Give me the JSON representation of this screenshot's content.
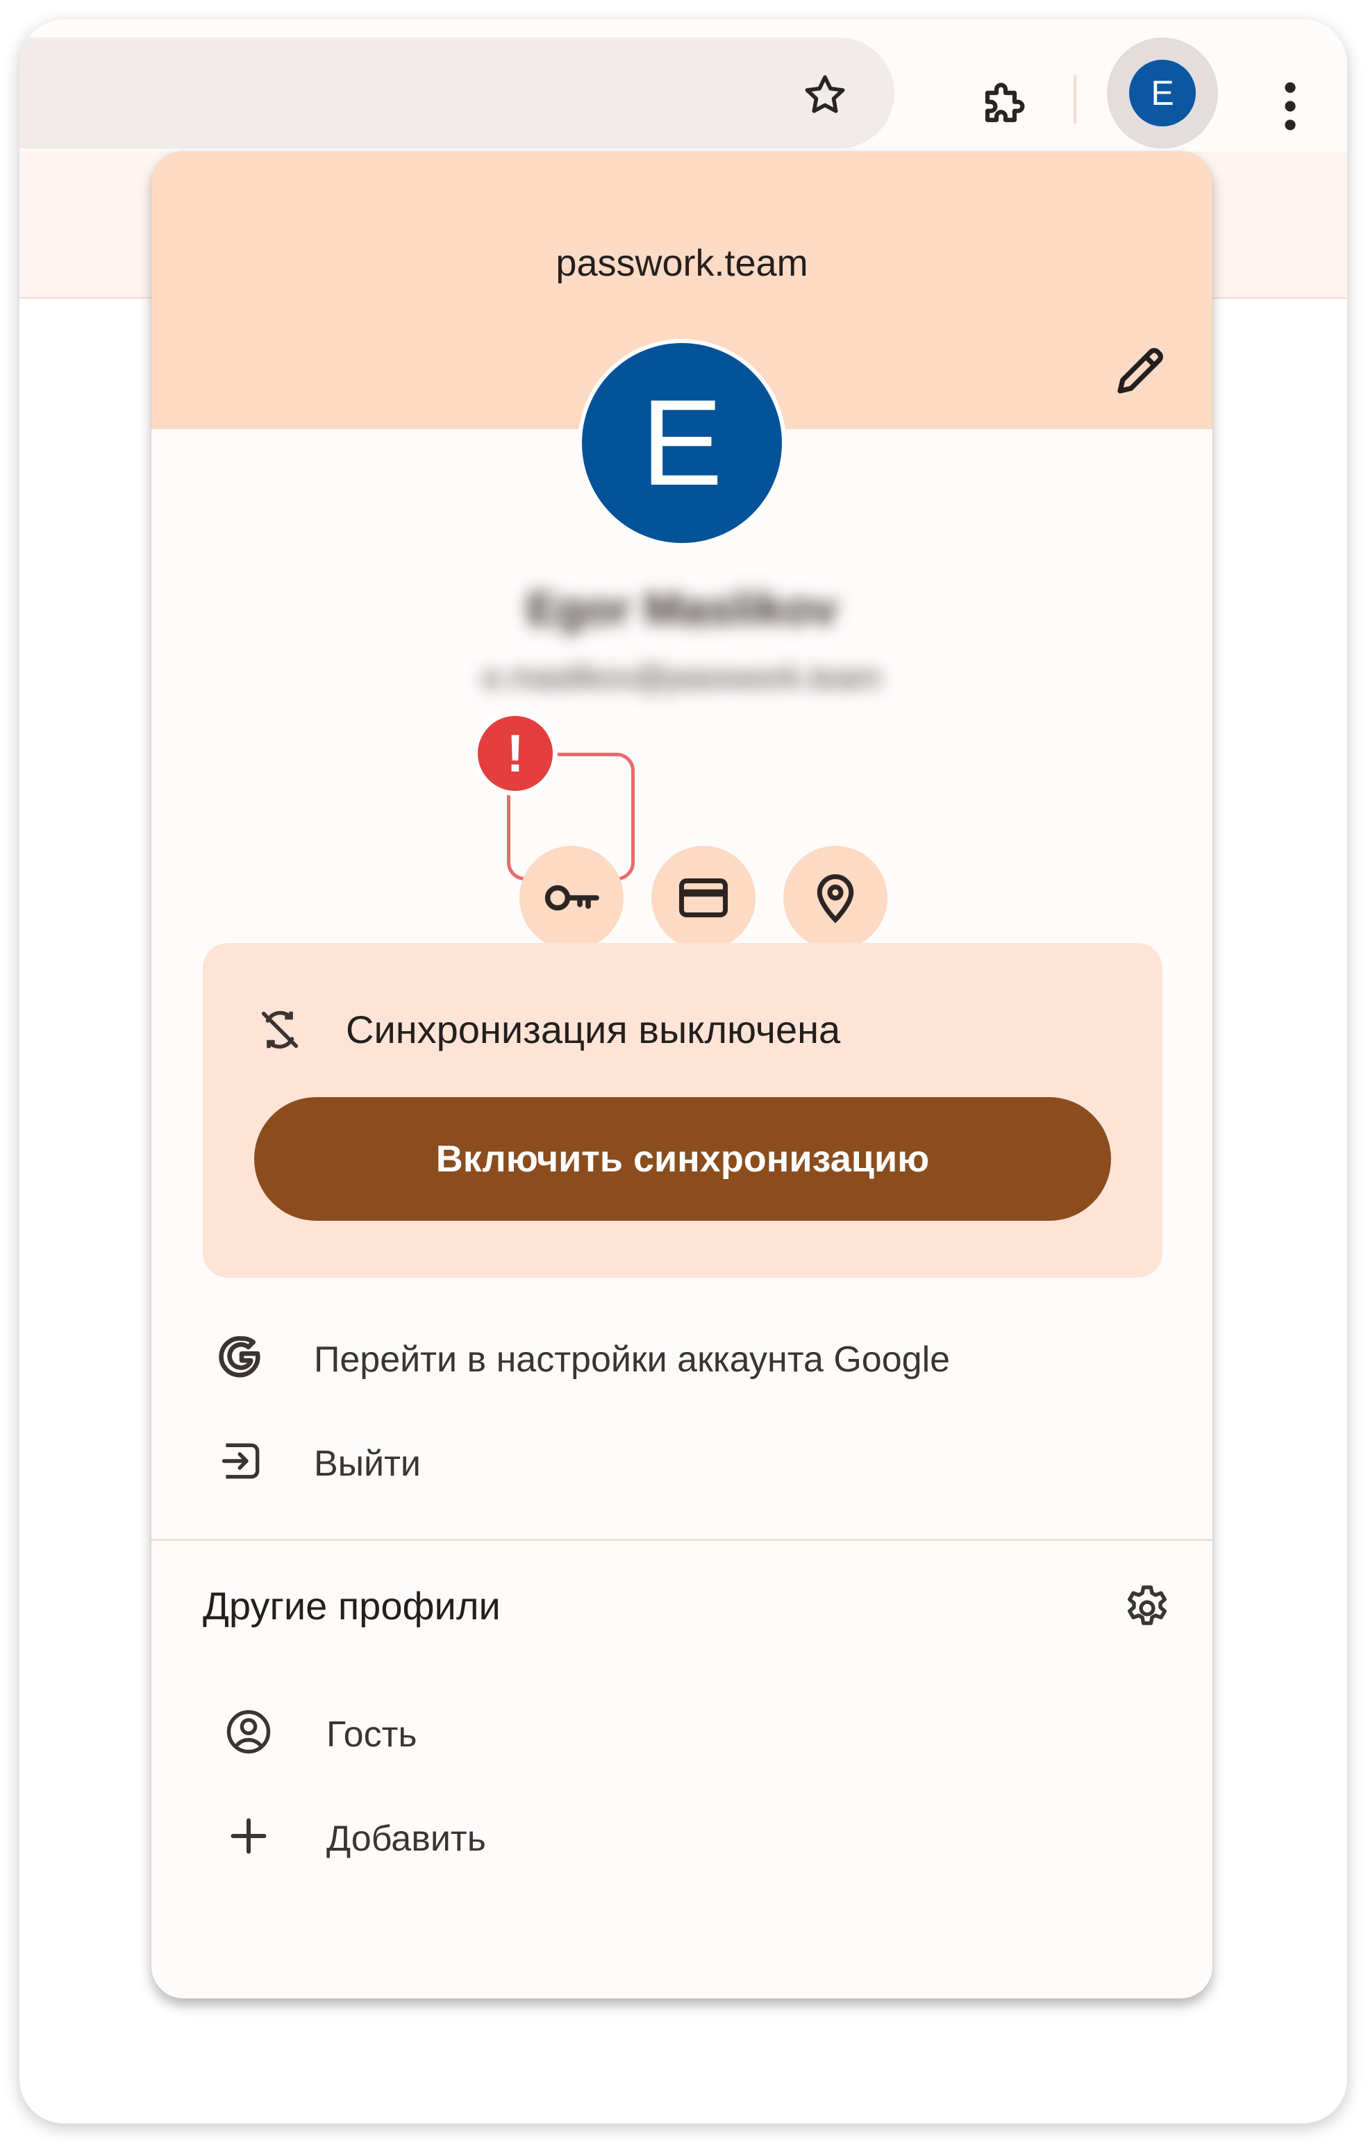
{
  "browser": {
    "star_icon": "star-outline-icon",
    "extensions_icon": "puzzle-icon",
    "profile_initial": "E",
    "menu_icon": "three-dots-vertical-icon"
  },
  "panel": {
    "title": "passwork.team",
    "edit_icon": "pencil-icon",
    "avatar_initial": "E",
    "user_name_blurred": "Egor Maslikov",
    "user_email_blurred": "e.maslikov@passwork.team",
    "quick_actions": [
      {
        "icon": "key-icon"
      },
      {
        "icon": "credit-card-icon"
      },
      {
        "icon": "location-pin-icon"
      }
    ],
    "alert_badge": "!",
    "sync": {
      "status": "Синхронизация выключена",
      "button": "Включить синхронизацию"
    },
    "menu": {
      "google_account": "Перейти в настройки аккаунта Google",
      "logout": "Выйти"
    },
    "other_profiles": {
      "title": "Другие профили",
      "guest": "Гость",
      "add": "Добавить"
    }
  },
  "colors": {
    "header": "#fddac4",
    "sync_button": "#8b4d1e",
    "avatar": "#045399",
    "alert": "#e53e3e"
  }
}
